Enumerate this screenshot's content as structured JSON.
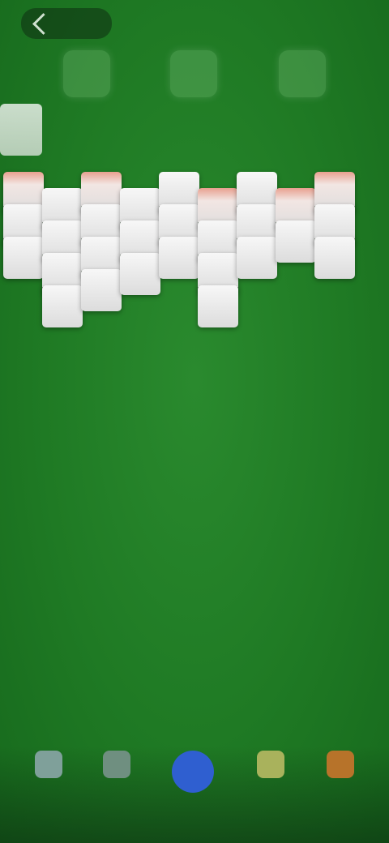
{
  "top_bar": {
    "back_label": ""
  },
  "header": {
    "icons": [
      "timer-icon",
      "moves-icon",
      "score-icon"
    ]
  },
  "tableau": {
    "columns": [
      {
        "cards": 3,
        "top_red": true
      },
      {
        "cards": 4,
        "top_red": false
      },
      {
        "cards": 4,
        "top_red": true
      },
      {
        "cards": 3,
        "top_red": false
      },
      {
        "cards": 3,
        "top_red": false
      },
      {
        "cards": 4,
        "top_red": true
      },
      {
        "cards": 3,
        "top_red": false
      },
      {
        "cards": 2,
        "top_red": true
      },
      {
        "cards": 3,
        "top_red": true
      }
    ]
  },
  "bottom_nav": {
    "items": [
      {
        "label": "",
        "icon": "settings-icon"
      },
      {
        "label": "",
        "icon": "hint-icon"
      },
      {
        "label": "",
        "icon": "play-icon"
      },
      {
        "label": "",
        "icon": "undo-icon"
      },
      {
        "label": "",
        "icon": "shop-icon"
      }
    ]
  },
  "colors": {
    "felt": "#1f7a24",
    "primary_button": "#2f5fd0"
  }
}
